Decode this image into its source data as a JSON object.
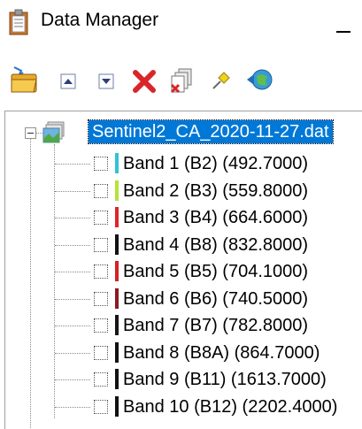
{
  "window": {
    "title": "Data Manager",
    "minimize_label": "—"
  },
  "toolbar": {
    "buttons": [
      {
        "icon": "open-folder-icon"
      },
      {
        "icon": "move-up-icon"
      },
      {
        "icon": "move-down-icon"
      },
      {
        "icon": "close-file-icon"
      },
      {
        "icon": "close-all-icon"
      },
      {
        "icon": "pin-icon"
      },
      {
        "icon": "load-bands-icon"
      }
    ]
  },
  "tree": {
    "file": {
      "name": "Sentinel2_CA_2020-11-27.dat",
      "icon": "raster-file-icon",
      "expanded": true
    },
    "bands": [
      {
        "label": "Band 1 (B2) (492.7000)",
        "color": "#2fc3d9"
      },
      {
        "label": "Band 2 (B3) (559.8000)",
        "color": "#b4e33a"
      },
      {
        "label": "Band 3 (B4) (664.6000)",
        "color": "#e0242a"
      },
      {
        "label": "Band 4 (B8) (832.8000)",
        "color": "#111111"
      },
      {
        "label": "Band 5 (B5) (704.1000)",
        "color": "#d81e26"
      },
      {
        "label": "Band 6 (B6) (740.5000)",
        "color": "#8a1a1f"
      },
      {
        "label": "Band 7 (B7) (782.8000)",
        "color": "#161616"
      },
      {
        "label": "Band 8 (B8A) (864.7000)",
        "color": "#111111"
      },
      {
        "label": "Band 9 (B11) (1613.7000)",
        "color": "#111111"
      },
      {
        "label": "Band 10 (B12) (2202.4000)",
        "color": "#111111"
      }
    ]
  }
}
